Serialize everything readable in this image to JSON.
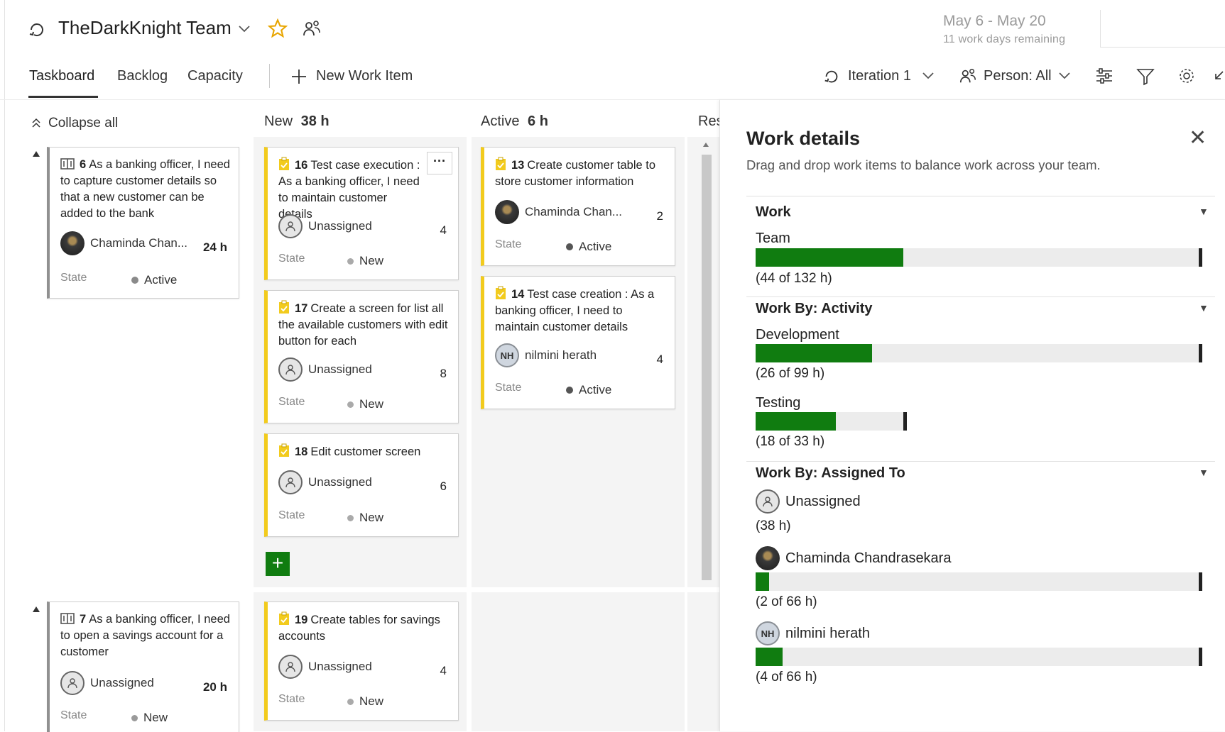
{
  "header": {
    "team_name": "TheDarkKnight Team",
    "sprint_dates": "May 6 - May 20",
    "sprint_remaining": "11 work days remaining"
  },
  "tabs": [
    {
      "label": "Taskboard",
      "active": true
    },
    {
      "label": "Backlog"
    },
    {
      "label": "Capacity"
    }
  ],
  "toolbar": {
    "new_item_label": "New Work Item",
    "iteration_label": "Iteration 1",
    "person_label": "Person: All"
  },
  "board": {
    "collapse_label": "Collapse all",
    "columns": [
      {
        "name": "New",
        "hours": "38 h"
      },
      {
        "name": "Active",
        "hours": "6 h"
      },
      {
        "name": "Res"
      }
    ],
    "state_label": "State",
    "stories": [
      {
        "id": "6",
        "title": "As a banking officer, I need to capture customer details so that a new customer can be added to the bank",
        "person": "Chaminda Chan...",
        "hours": "24 h",
        "state": "Active"
      },
      {
        "id": "7",
        "title": "As a banking officer, I need to open a savings account for a customer",
        "person": "Unassigned",
        "hours": "20 h",
        "state": "New"
      }
    ],
    "tasks": [
      {
        "id": "16",
        "title": "Test case execution : As a banking officer, I need to maintain customer details",
        "person": "Unassigned",
        "hours": "4",
        "state": "New"
      },
      {
        "id": "17",
        "title": "Create a screen for list all the available customers with edit button for each",
        "person": "Unassigned",
        "hours": "8",
        "state": "New"
      },
      {
        "id": "18",
        "title": "Edit customer screen",
        "person": "Unassigned",
        "hours": "6",
        "state": "New"
      },
      {
        "id": "13",
        "title": "Create customer table to store customer information",
        "person": "Chaminda Chan...",
        "hours": "2",
        "state": "Active"
      },
      {
        "id": "14",
        "title": "Test case creation : As a banking officer, I need to maintain customer details",
        "person": "nilmini herath",
        "hours": "4",
        "state": "Active"
      },
      {
        "id": "19",
        "title": "Create tables for savings accounts",
        "person": "Unassigned",
        "hours": "4",
        "state": "New"
      }
    ]
  },
  "work_details": {
    "title": "Work details",
    "subtitle": "Drag and drop work items to balance work across your team.",
    "work": {
      "heading": "Work",
      "label": "Team",
      "note": "(44 of 132 h)",
      "fraction": 0.333
    },
    "by_activity": {
      "heading": "Work By: Activity",
      "items": [
        {
          "label": "Development",
          "note": "(26 of 99 h)",
          "fraction": 0.263
        },
        {
          "label": "Testing",
          "note": "(18 of 33 h)",
          "fraction": 0.545
        }
      ]
    },
    "by_assigned": {
      "heading": "Work By: Assigned To",
      "items": [
        {
          "name": "Unassigned",
          "note": "(38 h)"
        },
        {
          "name": "Chaminda Chandrasekara",
          "note": "(2 of 66 h)",
          "fraction": 0.03
        },
        {
          "name": "nilmini herath",
          "note": "(4 of 66 h)",
          "fraction": 0.061
        }
      ]
    }
  },
  "initials": {
    "nilmini": "NH"
  },
  "colors": {
    "accent_green": "#107c10",
    "task_yellow": "#f2cb1d",
    "story_gray": "#909090"
  }
}
